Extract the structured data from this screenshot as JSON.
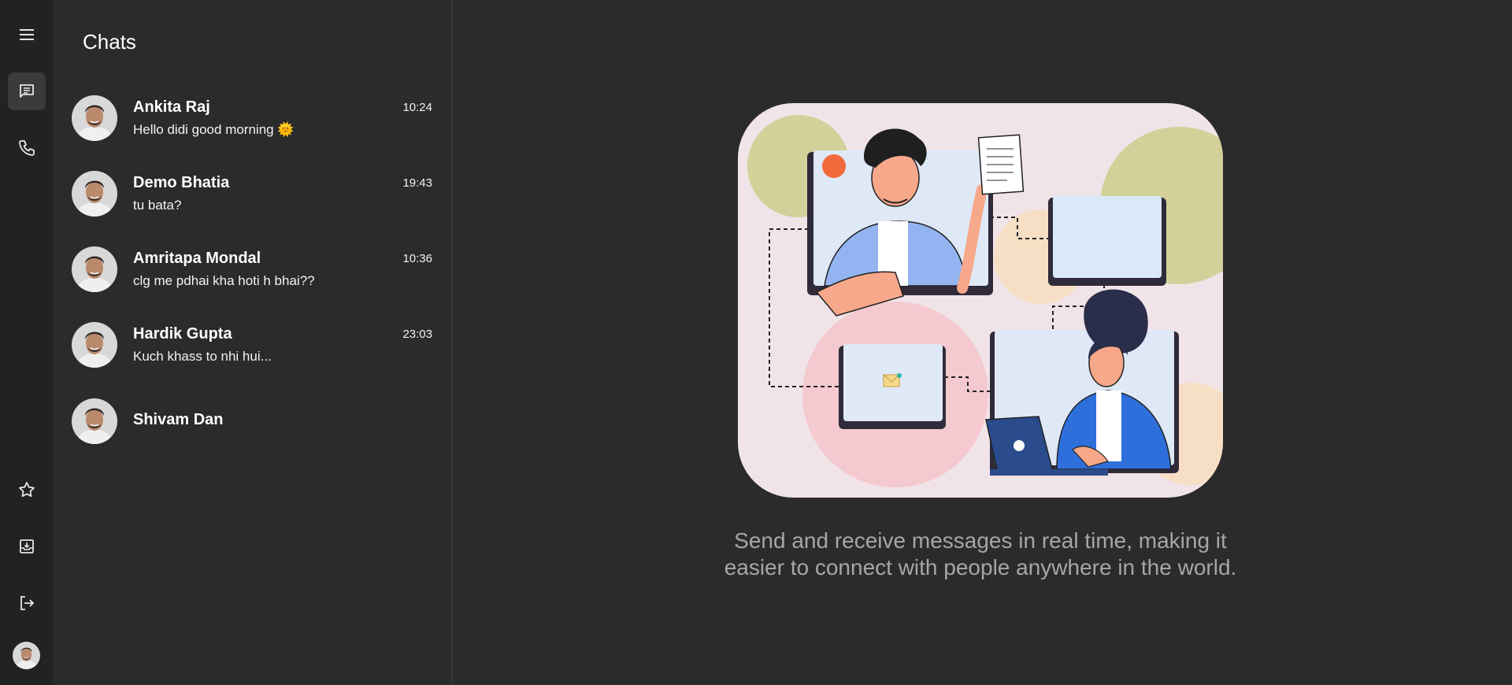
{
  "sidebar": {
    "menu_icon": "hamburger-menu-icon",
    "items": [
      {
        "name": "chats",
        "icon": "chat-icon",
        "active": true
      },
      {
        "name": "calls",
        "icon": "phone-icon",
        "active": false
      },
      {
        "name": "starred",
        "icon": "star-icon",
        "active": false
      },
      {
        "name": "archived",
        "icon": "archive-icon",
        "active": false
      },
      {
        "name": "logout",
        "icon": "logout-icon",
        "active": false
      }
    ]
  },
  "chat_list": {
    "title": "Chats",
    "chats": [
      {
        "name": "Ankita Raj",
        "message": "Hello didi good morning 🌞",
        "time": "10:24"
      },
      {
        "name": "Demo Bhatia",
        "message": "tu bata?",
        "time": "19:43"
      },
      {
        "name": "Amritapa Mondal",
        "message": "clg me pdhai kha hoti h bhai??",
        "time": "10:36"
      },
      {
        "name": "Hardik Gupta",
        "message": "Kuch khass to nhi hui...",
        "time": "23:03"
      },
      {
        "name": "Shivam Dan",
        "message": "",
        "time": ""
      }
    ]
  },
  "main": {
    "tagline_line1": "Send and receive messages in real time, making it",
    "tagline_line2": "easier to connect with people anywhere in the world."
  },
  "colors": {
    "rail_bg": "#222222",
    "panel_bg": "#2b2b2b",
    "illustration_bg": "#f1e4e8",
    "tagline": "#a6a6a6"
  }
}
